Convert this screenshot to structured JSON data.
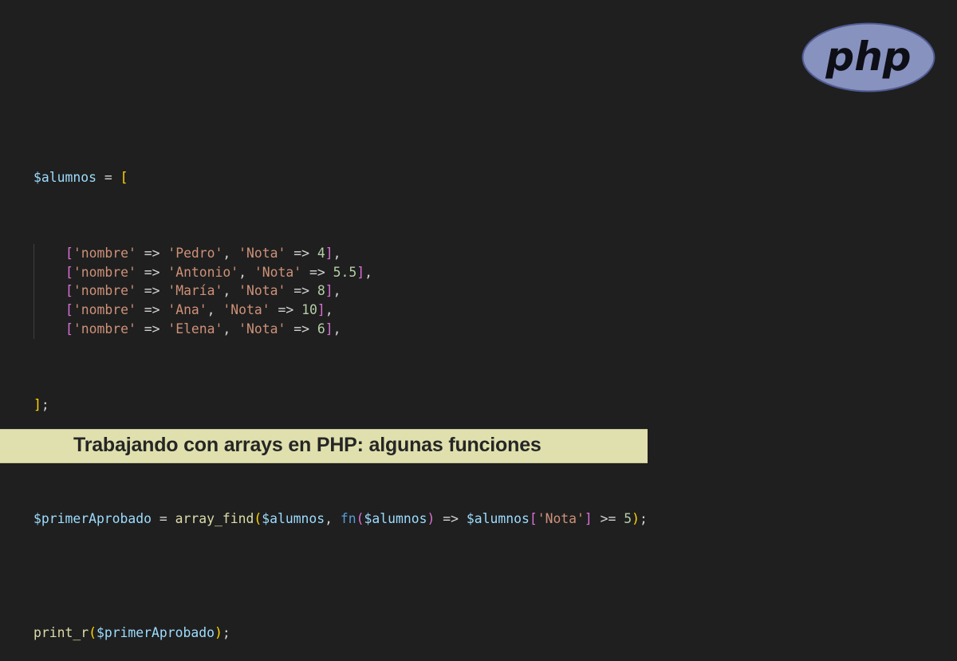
{
  "logo": {
    "text": "php",
    "colors": {
      "oval": "#8892bf",
      "outline": "#4f5b93",
      "text": "#0e0e16"
    }
  },
  "code": {
    "var_alumnos": "$alumnos",
    "var_primer": "$primerAprobado",
    "key_nombre": "'nombre'",
    "key_nota": "'Nota'",
    "arrow": "=>",
    "assign": "=",
    "fn_array_find": "array_find",
    "fn_print_r": "print_r",
    "kw_fn": "fn",
    "rows": [
      {
        "name": "'Pedro'",
        "nota": "4"
      },
      {
        "name": "'Antonio'",
        "nota": "5.5"
      },
      {
        "name": "'María'",
        "nota": "8"
      },
      {
        "name": "'Ana'",
        "nota": "10"
      },
      {
        "name": "'Elena'",
        "nota": "6"
      }
    ],
    "gte": ">=",
    "threshold": "5"
  },
  "banner": {
    "title": "Trabajando con arrays en PHP: algunas funciones"
  },
  "colors": {
    "background": "#1f1f1f",
    "banner": "#dfe0ad",
    "variable": "#9cdcfe",
    "string": "#ce9178",
    "number": "#b5cea8",
    "function": "#dcdcaa",
    "keyword": "#569cd6"
  }
}
